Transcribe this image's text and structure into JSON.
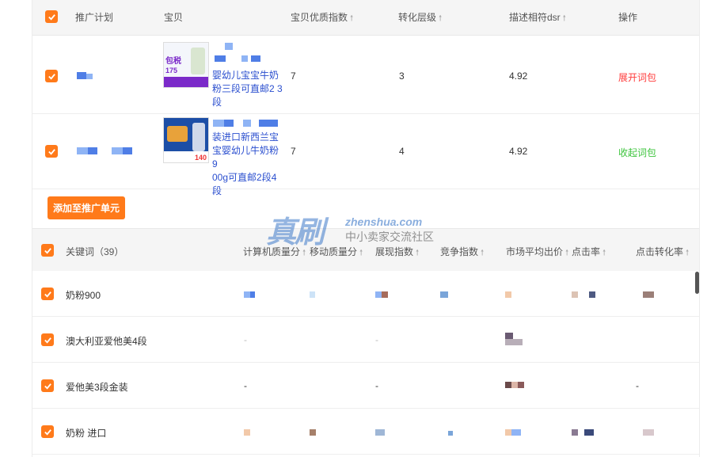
{
  "product_table": {
    "headers": {
      "plan": "推广计划",
      "item": "宝贝",
      "quality": "宝贝优质指数",
      "conversion": "转化层级",
      "dsr": "描述相符dsr",
      "action": "操作"
    },
    "rows": [
      {
        "title_line1": "婴幼儿宝宝牛奶",
        "title_line2": "粉三段可直邮2 3",
        "title_line3": "段",
        "thumb_tag": "包税",
        "thumb_price": "175",
        "quality": "7",
        "conversion": "3",
        "dsr": "4.92",
        "action": "展开词包"
      },
      {
        "title_line1": "装进口新西兰宝",
        "title_line2": "宝婴幼儿牛奶粉9",
        "title_line3": "00g可直邮2段4",
        "title_line4": "段",
        "thumb_price": "140",
        "quality": "7",
        "conversion": "4",
        "dsr": "4.92",
        "action": "收起词包"
      }
    ]
  },
  "add_button": "添加至推广单元",
  "keyword_table": {
    "headers": {
      "keyword": "关键词（39）",
      "pc_quality": "计算机质量分",
      "mobile_quality": "移动质量分",
      "impressions": "展现指数",
      "competition": "竞争指数",
      "avg_bid": "市场平均出价",
      "ctr": "点击率",
      "cvr": "点击转化率"
    },
    "rows": [
      {
        "keyword": "奶粉900",
        "pc": "",
        "mobile": "",
        "impressions": "",
        "competition": "",
        "avg_bid": "",
        "ctr": "",
        "cvr": ""
      },
      {
        "keyword": "澳大利亚爱他美4段",
        "pc": "-",
        "mobile": "",
        "impressions": "-",
        "competition": "",
        "avg_bid": "",
        "ctr": "",
        "cvr": ""
      },
      {
        "keyword": "爱他美3段金装",
        "pc": "-",
        "mobile": "",
        "impressions": "-",
        "competition": "",
        "avg_bid": "",
        "ctr": "",
        "cvr": "-"
      },
      {
        "keyword": "奶粉 进口",
        "pc": "",
        "mobile": "",
        "impressions": "",
        "competition": "",
        "avg_bid": "",
        "ctr": "",
        "cvr": ""
      }
    ]
  },
  "watermark": {
    "brand": "真刷",
    "domain": "zhenshua.com",
    "slogan": "中小卖家交流社区"
  },
  "colors": {
    "accent": "#ff7a1a",
    "expand": "#ff3b3b",
    "collapse": "#3cc43c",
    "link": "#2b4fcf"
  },
  "icons": {
    "checkbox": "check-icon",
    "sort": "sort-arrow-up-icon"
  }
}
